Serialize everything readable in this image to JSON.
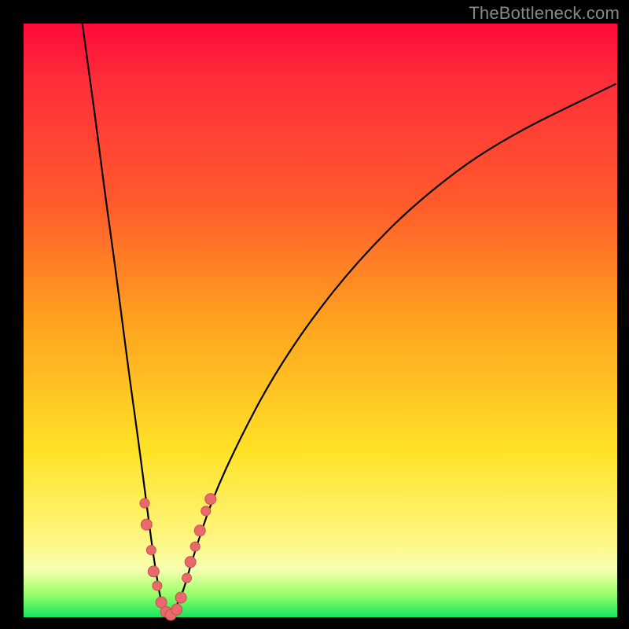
{
  "watermark": "TheBottleneck.com",
  "colors": {
    "frame": "#000000",
    "gradient_top": "#ff0a3a",
    "gradient_mid_orange": "#ff5a2c",
    "gradient_mid_yellow": "#ffe227",
    "gradient_bottom_green": "#16e85e",
    "curve_stroke": "#000000",
    "marker_fill": "#e86a6a",
    "marker_stroke": "#c94f4f"
  },
  "chart_data": {
    "type": "line",
    "title": "",
    "xlabel": "",
    "ylabel": "",
    "xlim": [
      0,
      100
    ],
    "ylim": [
      0,
      100
    ],
    "grid": false,
    "curve_points": [
      {
        "x": 9.9,
        "y": 100.0
      },
      {
        "x": 11.3,
        "y": 90.0
      },
      {
        "x": 12.6,
        "y": 80.0
      },
      {
        "x": 13.9,
        "y": 70.0
      },
      {
        "x": 15.3,
        "y": 60.0
      },
      {
        "x": 16.6,
        "y": 50.0
      },
      {
        "x": 17.9,
        "y": 40.0
      },
      {
        "x": 19.3,
        "y": 30.0
      },
      {
        "x": 20.6,
        "y": 20.0
      },
      {
        "x": 21.9,
        "y": 10.0
      },
      {
        "x": 23.4,
        "y": 1.0
      },
      {
        "x": 24.5,
        "y": 0.3
      },
      {
        "x": 26.5,
        "y": 3.0
      },
      {
        "x": 28.5,
        "y": 10.0
      },
      {
        "x": 31.8,
        "y": 20.0
      },
      {
        "x": 36.4,
        "y": 30.0
      },
      {
        "x": 41.7,
        "y": 40.0
      },
      {
        "x": 48.3,
        "y": 50.0
      },
      {
        "x": 56.3,
        "y": 60.0
      },
      {
        "x": 66.2,
        "y": 70.0
      },
      {
        "x": 79.5,
        "y": 80.0
      },
      {
        "x": 99.7,
        "y": 89.8
      }
    ],
    "markers": [
      {
        "x": 20.4,
        "y": 19.2,
        "r": 6
      },
      {
        "x": 20.7,
        "y": 15.6,
        "r": 7
      },
      {
        "x": 21.5,
        "y": 11.3,
        "r": 6
      },
      {
        "x": 21.9,
        "y": 7.7,
        "r": 7
      },
      {
        "x": 22.5,
        "y": 5.3,
        "r": 6
      },
      {
        "x": 23.2,
        "y": 2.5,
        "r": 7
      },
      {
        "x": 24.0,
        "y": 0.9,
        "r": 7
      },
      {
        "x": 24.8,
        "y": 0.4,
        "r": 7
      },
      {
        "x": 25.8,
        "y": 1.3,
        "r": 7
      },
      {
        "x": 26.5,
        "y": 3.3,
        "r": 7
      },
      {
        "x": 27.5,
        "y": 6.6,
        "r": 6
      },
      {
        "x": 28.1,
        "y": 9.3,
        "r": 7
      },
      {
        "x": 28.9,
        "y": 11.9,
        "r": 6
      },
      {
        "x": 29.7,
        "y": 14.6,
        "r": 7
      },
      {
        "x": 30.7,
        "y": 17.9,
        "r": 6
      },
      {
        "x": 31.5,
        "y": 19.9,
        "r": 7
      }
    ]
  }
}
